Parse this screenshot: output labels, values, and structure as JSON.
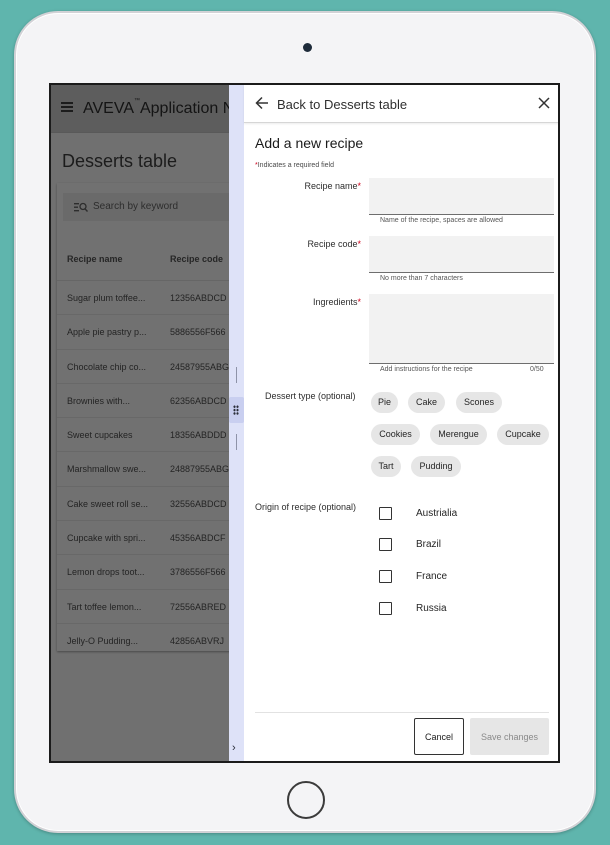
{
  "app": {
    "name": "AVEVA",
    "name_sup": "™",
    "name_rest": "Application N",
    "page_title": "Desserts table",
    "search_placeholder": "Search by keyword",
    "columns": [
      "Recipe name",
      "Recipe code"
    ],
    "rows": [
      [
        "Sugar plum toffee...",
        "12356ABDCD"
      ],
      [
        "Apple pie pastry p...",
        "5886556F566"
      ],
      [
        "Chocolate chip co...",
        "24587955ABG"
      ],
      [
        "Brownies with...",
        "62356ABDCD"
      ],
      [
        "Sweet cupcakes",
        "18356ABDDD"
      ],
      [
        "Marshmallow swe...",
        "24887955ABG"
      ],
      [
        "Cake sweet roll se...",
        "32556ABDCD"
      ],
      [
        "Cupcake with spri...",
        "45356ABDCF"
      ],
      [
        "Lemon drops toot...",
        "3786556F566"
      ],
      [
        "Tart toffee lemon...",
        "72556ABRED"
      ],
      [
        "Jelly-O Pudding...",
        "42856ABVRJ"
      ]
    ]
  },
  "rail": {
    "chevron": "›"
  },
  "panel": {
    "back_label": "Back to Desserts table",
    "title": "Add a new recipe",
    "required_star": "*",
    "required_note": "Indicates a required field",
    "fields": {
      "recipe_name": {
        "label": "Recipe name",
        "value": "",
        "help": "Name of the recipe, spaces are allowed"
      },
      "recipe_code": {
        "label": "Recipe code",
        "value": "",
        "help": "No more than 7 characters"
      },
      "ingredients": {
        "label": "Ingredients",
        "value": "",
        "help": "Add instructions for the recipe",
        "counter": "0/50"
      }
    },
    "dessert_type_label": "Dessert type (optional)",
    "dessert_types": [
      "Pie",
      "Cake",
      "Scones",
      "Cookies",
      "Merengue",
      "Cupcake",
      "Tart",
      "Pudding"
    ],
    "origin_label": "Origin of recipe (optional)",
    "origins": [
      {
        "label": "Austrialia",
        "checked": false
      },
      {
        "label": "Brazil",
        "checked": false
      },
      {
        "label": "France",
        "checked": false
      },
      {
        "label": "Russia",
        "checked": false
      }
    ],
    "cancel_label": "Cancel",
    "save_label": "Save changes"
  }
}
